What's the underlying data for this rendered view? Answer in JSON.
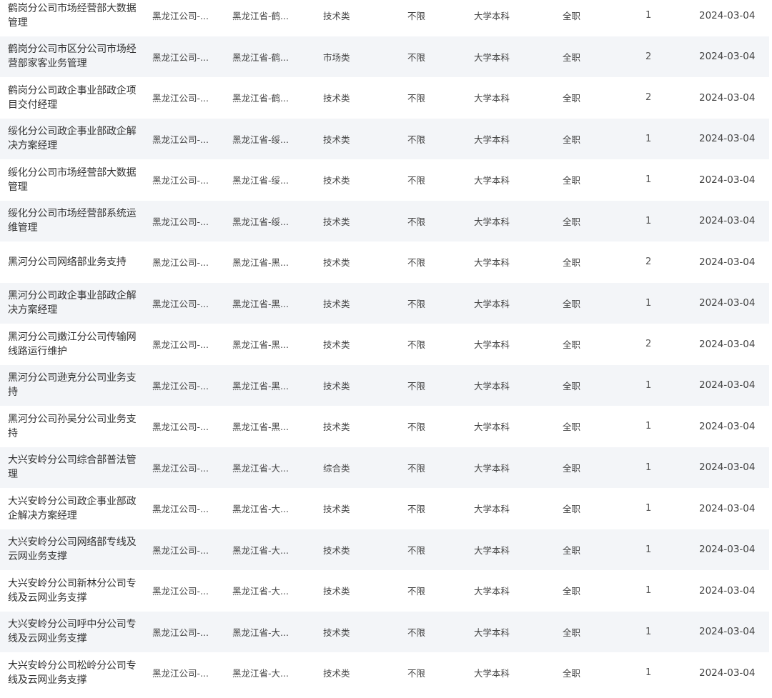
{
  "rows": [
    {
      "title": "鹤岗分公司市场经营部大数据管理",
      "company": "黑龙江公司-...",
      "location": "黑龙江省-鹤...",
      "category": "技术类",
      "experience": "不限",
      "education": "大学本科",
      "type": "全职",
      "count": "1",
      "date": "2024-03-04"
    },
    {
      "title": "鹤岗分公司市区分公司市场经营部家客业务管理",
      "company": "黑龙江公司-...",
      "location": "黑龙江省-鹤...",
      "category": "市场类",
      "experience": "不限",
      "education": "大学本科",
      "type": "全职",
      "count": "2",
      "date": "2024-03-04"
    },
    {
      "title": "鹤岗分公司政企事业部政企项目交付经理",
      "company": "黑龙江公司-...",
      "location": "黑龙江省-鹤...",
      "category": "技术类",
      "experience": "不限",
      "education": "大学本科",
      "type": "全职",
      "count": "2",
      "date": "2024-03-04"
    },
    {
      "title": "绥化分公司政企事业部政企解决方案经理",
      "company": "黑龙江公司-...",
      "location": "黑龙江省-绥...",
      "category": "技术类",
      "experience": "不限",
      "education": "大学本科",
      "type": "全职",
      "count": "1",
      "date": "2024-03-04"
    },
    {
      "title": "绥化分公司市场经营部大数据管理",
      "company": "黑龙江公司-...",
      "location": "黑龙江省-绥...",
      "category": "技术类",
      "experience": "不限",
      "education": "大学本科",
      "type": "全职",
      "count": "1",
      "date": "2024-03-04"
    },
    {
      "title": "绥化分公司市场经营部系统运维管理",
      "company": "黑龙江公司-...",
      "location": "黑龙江省-绥...",
      "category": "技术类",
      "experience": "不限",
      "education": "大学本科",
      "type": "全职",
      "count": "1",
      "date": "2024-03-04"
    },
    {
      "title": "黑河分公司网络部业务支持",
      "company": "黑龙江公司-...",
      "location": "黑龙江省-黑...",
      "category": "技术类",
      "experience": "不限",
      "education": "大学本科",
      "type": "全职",
      "count": "2",
      "date": "2024-03-04"
    },
    {
      "title": "黑河分公司政企事业部政企解决方案经理",
      "company": "黑龙江公司-...",
      "location": "黑龙江省-黑...",
      "category": "技术类",
      "experience": "不限",
      "education": "大学本科",
      "type": "全职",
      "count": "1",
      "date": "2024-03-04"
    },
    {
      "title": "黑河分公司嫩江分公司传输网线路运行维护",
      "company": "黑龙江公司-...",
      "location": "黑龙江省-黑...",
      "category": "技术类",
      "experience": "不限",
      "education": "大学本科",
      "type": "全职",
      "count": "2",
      "date": "2024-03-04"
    },
    {
      "title": "黑河分公司逊克分公司业务支持",
      "company": "黑龙江公司-...",
      "location": "黑龙江省-黑...",
      "category": "技术类",
      "experience": "不限",
      "education": "大学本科",
      "type": "全职",
      "count": "1",
      "date": "2024-03-04"
    },
    {
      "title": "黑河分公司孙吴分公司业务支持",
      "company": "黑龙江公司-...",
      "location": "黑龙江省-黑...",
      "category": "技术类",
      "experience": "不限",
      "education": "大学本科",
      "type": "全职",
      "count": "1",
      "date": "2024-03-04"
    },
    {
      "title": "大兴安岭分公司综合部普法管理",
      "company": "黑龙江公司-...",
      "location": "黑龙江省-大...",
      "category": "综合类",
      "experience": "不限",
      "education": "大学本科",
      "type": "全职",
      "count": "1",
      "date": "2024-03-04"
    },
    {
      "title": "大兴安岭分公司政企事业部政企解决方案经理",
      "company": "黑龙江公司-...",
      "location": "黑龙江省-大...",
      "category": "技术类",
      "experience": "不限",
      "education": "大学本科",
      "type": "全职",
      "count": "1",
      "date": "2024-03-04"
    },
    {
      "title": "大兴安岭分公司网络部专线及云网业务支撑",
      "company": "黑龙江公司-...",
      "location": "黑龙江省-大...",
      "category": "技术类",
      "experience": "不限",
      "education": "大学本科",
      "type": "全职",
      "count": "1",
      "date": "2024-03-04"
    },
    {
      "title": "大兴安岭分公司新林分公司专线及云网业务支撑",
      "company": "黑龙江公司-...",
      "location": "黑龙江省-大...",
      "category": "技术类",
      "experience": "不限",
      "education": "大学本科",
      "type": "全职",
      "count": "1",
      "date": "2024-03-04"
    },
    {
      "title": "大兴安岭分公司呼中分公司专线及云网业务支撑",
      "company": "黑龙江公司-...",
      "location": "黑龙江省-大...",
      "category": "技术类",
      "experience": "不限",
      "education": "大学本科",
      "type": "全职",
      "count": "1",
      "date": "2024-03-04"
    },
    {
      "title": "大兴安岭分公司松岭分公司专线及云网业务支撑",
      "company": "黑龙江公司-...",
      "location": "黑龙江省-大...",
      "category": "技术类",
      "experience": "不限",
      "education": "大学本科",
      "type": "全职",
      "count": "1",
      "date": "2024-03-04"
    }
  ]
}
